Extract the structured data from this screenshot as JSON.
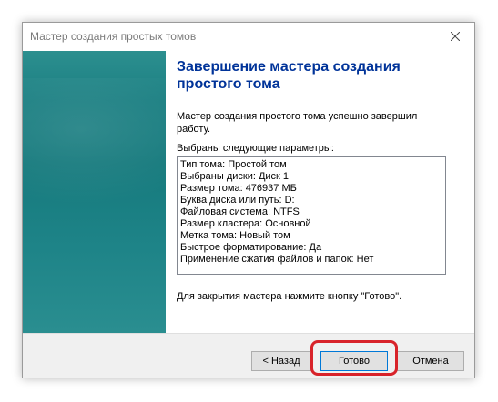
{
  "window": {
    "title": "Мастер создания простых томов"
  },
  "main": {
    "heading": "Завершение мастера создания простого тома",
    "description": "Мастер создания простого тома успешно завершил работу.",
    "params_label": "Выбраны следующие параметры:",
    "params": [
      "Тип тома: Простой том",
      "Выбраны диски: Диск 1",
      "Размер тома: 476937 МБ",
      "Буква диска или путь: D:",
      "Файловая система: NTFS",
      "Размер кластера: Основной",
      "Метка тома: Новый том",
      "Быстрое форматирование: Да",
      "Применение сжатия файлов и папок: Нет"
    ],
    "finish_note": "Для закрытия мастера нажмите кнопку \"Готово\"."
  },
  "buttons": {
    "back": "< Назад",
    "finish": "Готово",
    "cancel": "Отмена"
  },
  "colors": {
    "heading": "#003399",
    "side_panel": "#1b7f82",
    "highlight": "#d8232a",
    "default_button_border": "#0078d7"
  },
  "icons": {
    "close": "close-icon"
  }
}
